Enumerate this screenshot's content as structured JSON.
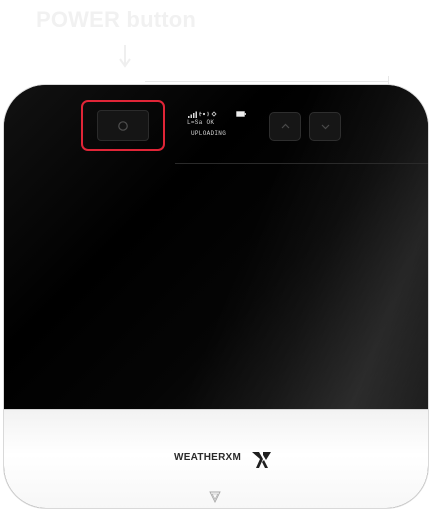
{
  "annotation": {
    "title": "POWER button"
  },
  "device": {
    "brand": "WEATHERXM",
    "status_line": "L=Sa  OK",
    "status_text": "UPLOADING"
  },
  "icons": {
    "down_arrow": "arrow-down-icon",
    "power": "power-icon",
    "signal": "signal-icon",
    "battery": "battery-icon",
    "up": "chevron-up-icon",
    "down": "chevron-down-icon",
    "logo": "weatherxm-logo-icon"
  },
  "colors": {
    "highlight": "#e02537",
    "device_black": "#000000",
    "device_white": "#f7f7f7"
  }
}
